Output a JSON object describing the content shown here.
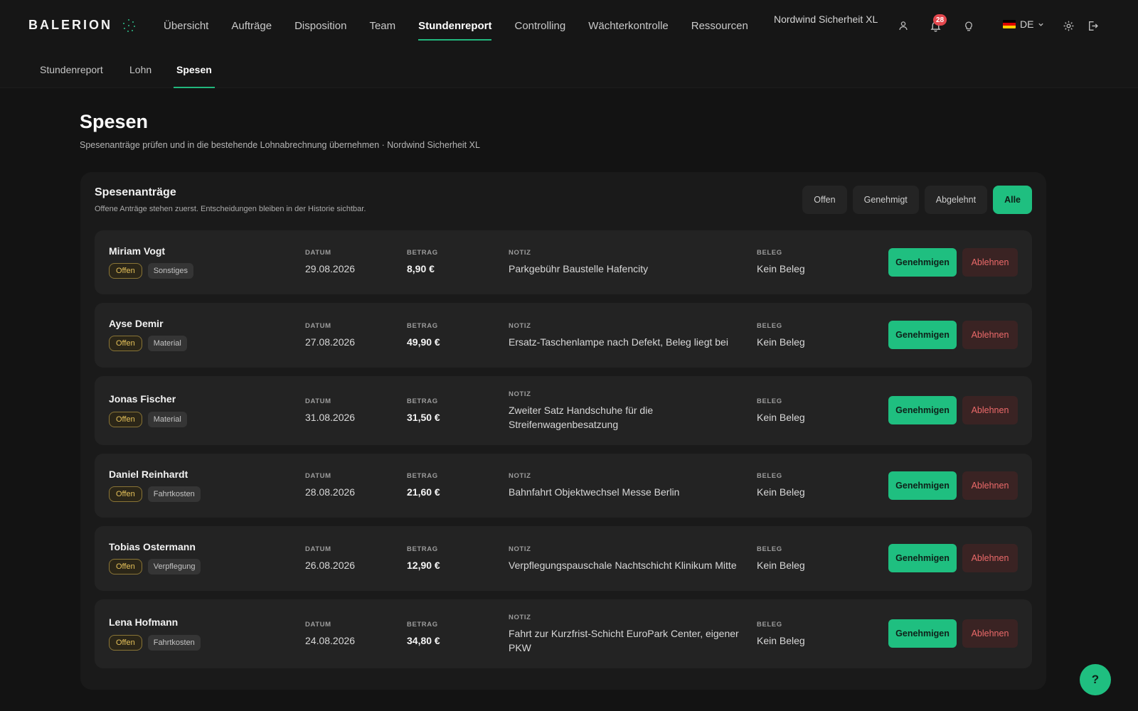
{
  "brand": {
    "logo_text": "BALERION"
  },
  "nav": {
    "items": [
      {
        "label": "Übersicht",
        "active": false
      },
      {
        "label": "Aufträge",
        "active": false
      },
      {
        "label": "Disposition",
        "active": false
      },
      {
        "label": "Team",
        "active": false
      },
      {
        "label": "Stundenreport",
        "active": true
      },
      {
        "label": "Controlling",
        "active": false
      },
      {
        "label": "Wächterkontrolle",
        "active": false
      },
      {
        "label": "Ressourcen",
        "active": false
      }
    ]
  },
  "header": {
    "tenant": "Nordwind Sicherheit XL",
    "notifications_count": "28",
    "language": "DE",
    "icons": [
      "user-icon",
      "bell-icon",
      "lightbulb-icon",
      "gear-icon",
      "logout-icon"
    ]
  },
  "subnav": {
    "items": [
      {
        "label": "Stundenreport",
        "active": false
      },
      {
        "label": "Lohn",
        "active": false
      },
      {
        "label": "Spesen",
        "active": true
      }
    ]
  },
  "page": {
    "title": "Spesen",
    "subtitle": "Spesenanträge prüfen und in die bestehende Lohnabrechnung übernehmen · Nordwind Sicherheit XL"
  },
  "card": {
    "title": "Spesenanträge",
    "subtitle": "Offene Anträge stehen zuerst. Entscheidungen bleiben in der Historie sichtbar.",
    "filters": [
      {
        "label": "Offen",
        "active": false
      },
      {
        "label": "Genehmigt",
        "active": false
      },
      {
        "label": "Abgelehnt",
        "active": false
      },
      {
        "label": "Alle",
        "active": true
      }
    ],
    "field_labels": {
      "date": "DATUM",
      "amount": "BETRAG",
      "note": "NOTIZ",
      "receipt": "BELEG"
    },
    "approve_label": "Genehmigen",
    "reject_label": "Ablehnen",
    "rows": [
      {
        "name": "Miriam Vogt",
        "status": "Offen",
        "category": "Sonstiges",
        "date": "29.08.2026",
        "amount": "8,90 €",
        "note": "Parkgebühr Baustelle Hafencity",
        "receipt": "Kein Beleg"
      },
      {
        "name": "Ayse Demir",
        "status": "Offen",
        "category": "Material",
        "date": "27.08.2026",
        "amount": "49,90 €",
        "note": "Ersatz-Taschenlampe nach Defekt, Beleg liegt bei",
        "receipt": "Kein Beleg"
      },
      {
        "name": "Jonas Fischer",
        "status": "Offen",
        "category": "Material",
        "date": "31.08.2026",
        "amount": "31,50 €",
        "note": "Zweiter Satz Handschuhe für die Streifenwagenbesatzung",
        "receipt": "Kein Beleg"
      },
      {
        "name": "Daniel Reinhardt",
        "status": "Offen",
        "category": "Fahrtkosten",
        "date": "28.08.2026",
        "amount": "21,60 €",
        "note": "Bahnfahrt Objektwechsel Messe Berlin",
        "receipt": "Kein Beleg"
      },
      {
        "name": "Tobias Ostermann",
        "status": "Offen",
        "category": "Verpflegung",
        "date": "26.08.2026",
        "amount": "12,90 €",
        "note": "Verpflegungspauschale Nachtschicht Klinikum Mitte",
        "receipt": "Kein Beleg"
      },
      {
        "name": "Lena Hofmann",
        "status": "Offen",
        "category": "Fahrtkosten",
        "date": "24.08.2026",
        "amount": "34,80 €",
        "note": "Fahrt zur Kurzfrist-Schicht EuroPark Center, eigener PKW",
        "receipt": "Kein Beleg"
      }
    ]
  },
  "help": {
    "label": "?"
  },
  "colors": {
    "accent": "#1fbf80",
    "danger": "#ec6a6a",
    "pending": "#e6c25a",
    "background": "#131313"
  }
}
